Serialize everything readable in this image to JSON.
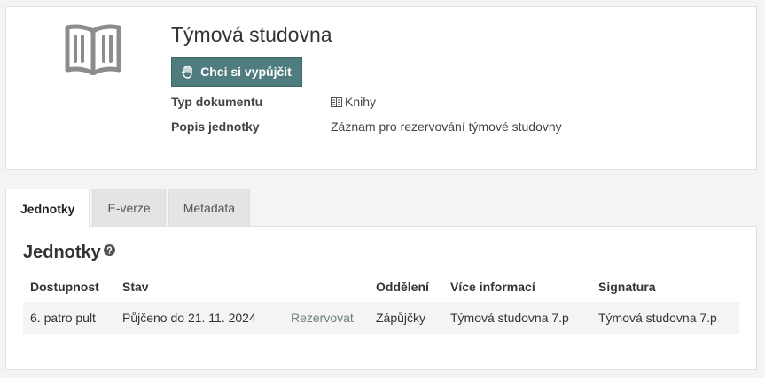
{
  "record": {
    "title": "Týmová studovna",
    "borrow_button": "Chci si vypůjčit",
    "meta": [
      {
        "label": "Typ dokumentu",
        "value": "Knihy",
        "icon": "book-small-icon"
      },
      {
        "label": "Popis jednotky",
        "value": "Záznam pro rezervování týmové studovny"
      }
    ]
  },
  "tabs": [
    {
      "label": "Jednotky",
      "active": true
    },
    {
      "label": "E-verze",
      "active": false
    },
    {
      "label": "Metadata",
      "active": false
    }
  ],
  "units": {
    "title": "Jednotky",
    "columns": [
      "Dostupnost",
      "Stav",
      "",
      "Oddělení",
      "Více informací",
      "Signatura"
    ],
    "rows": [
      {
        "availability": "6. patro pult",
        "status": "Půjčeno do 21. 11. 2024",
        "action": "Rezervovat",
        "department": "Zápůjčky",
        "info": "Týmová studovna 7.p",
        "signature": "Týmová studovna 7.p"
      }
    ]
  },
  "colors": {
    "accent": "#4f7d7f",
    "link": "#6e7f7e"
  }
}
